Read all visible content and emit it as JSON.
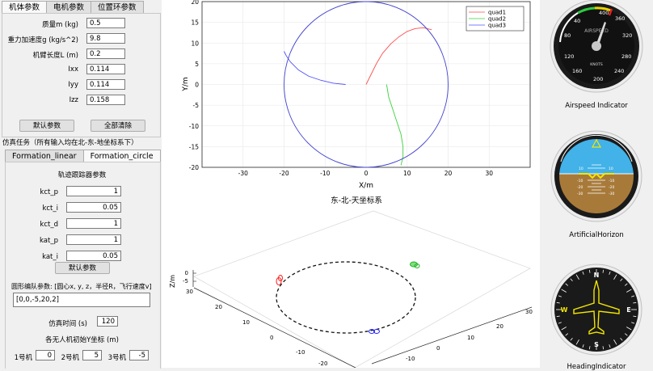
{
  "left": {
    "tabs_top": [
      "机体参数",
      "电机参数",
      "位置环参数"
    ],
    "params": [
      {
        "label": "质量m (kg)",
        "value": "0.5"
      },
      {
        "label": "重力加速度g (kg/s^2)",
        "value": "9.8"
      },
      {
        "label": "机臂长度L (m)",
        "value": "0.2"
      },
      {
        "label": "Ixx",
        "value": "0.114"
      },
      {
        "label": "Iyy",
        "value": "0.114"
      },
      {
        "label": "Izz",
        "value": "0.158"
      }
    ],
    "default_btn": "默认参数",
    "clear_btn": "全部清除",
    "task_title": "仿真任务（所有输入均在北-东-地坐标系下）",
    "tabs_task": [
      "Formation_linear",
      "Formation_circle"
    ],
    "ctrl_title": "轨迹跟踪器参数",
    "ctrl": [
      {
        "label": "kct_p",
        "value": "1"
      },
      {
        "label": "kct_i",
        "value": "0.05"
      },
      {
        "label": "kct_d",
        "value": "1"
      },
      {
        "label": "kat_p",
        "value": "1"
      },
      {
        "label": "kat_i",
        "value": "0.05"
      }
    ],
    "ctrl_default_btn": "默认参数",
    "circle_label": "圆形编队参数: [圆心x, y, z，半径R，飞行速度v]",
    "circle_value": "[0,0,-5,20,2]",
    "simtime_label": "仿真时间 (s)",
    "simtime_value": "120",
    "y_title": "各无人机初始Y坐标 (m)",
    "drones": [
      {
        "label": "1号机",
        "value": "0"
      },
      {
        "label": "2号机",
        "value": "5"
      },
      {
        "label": "3号机",
        "value": "-5"
      }
    ]
  },
  "plot2d": {
    "xlabel": "X/m",
    "ylabel": "Y/m",
    "xticks": [
      "-30",
      "-20",
      "-10",
      "0",
      "10",
      "20",
      "30"
    ],
    "yticks": [
      "20",
      "15",
      "10",
      "5",
      "0",
      "-5",
      "-10",
      "-15",
      "-20"
    ],
    "legend": [
      "quad1",
      "quad2",
      "quad3"
    ]
  },
  "plot3d": {
    "title": "东-北-天坐标系",
    "zlabel": "Z/m",
    "zticks": [
      "0",
      "-5"
    ],
    "xticks": [
      "30",
      "20",
      "10",
      "0",
      "-10",
      "-20"
    ],
    "yticks": [
      "30",
      "20",
      "10",
      "0",
      "-10"
    ]
  },
  "instruments": {
    "airspeed_label": "Airspeed Indicator",
    "airspeed_title": "AIRSPEED",
    "airspeed_unit": "KNOTS",
    "airspeed_nums": [
      "400",
      "360",
      "40",
      "320",
      "80",
      "280",
      "120",
      "240",
      "160",
      "200"
    ],
    "horizon_label": "ArtificialHorizon",
    "horizon_nums": [
      "10",
      "10",
      "-10",
      "-10",
      "-20",
      "-20",
      "-30",
      "-30"
    ],
    "heading_label": "HeadingIndicator",
    "heading_letters": [
      "N",
      "E",
      "S",
      "W"
    ]
  },
  "chart_data": {
    "type": "line",
    "xlabel": "X/m",
    "ylabel": "Y/m",
    "xlim": [
      -40,
      40
    ],
    "ylim": [
      -20,
      20
    ],
    "grid": true,
    "legend_position": "top-right",
    "series": [
      {
        "name": "quad1",
        "color": "#ff4d4d",
        "x": [
          0,
          1,
          2.5,
          4,
          6,
          8,
          10,
          12,
          14,
          16
        ],
        "y": [
          0,
          2,
          5,
          7.5,
          9.8,
          11.5,
          12.8,
          13.5,
          13.7,
          13.2
        ]
      },
      {
        "name": "quad2",
        "color": "#3ad13a",
        "x": [
          5,
          5.5,
          6.5,
          7.5,
          8.5,
          9.0,
          9.0,
          8.5
        ],
        "y": [
          0,
          -3,
          -6,
          -9,
          -12,
          -15,
          -17.5,
          -19.5
        ]
      },
      {
        "name": "quad3",
        "color": "#5050ff",
        "x": [
          -5,
          -8,
          -11,
          -14,
          -16.5,
          -18.5,
          -19.5,
          -20
        ],
        "y": [
          0,
          0.3,
          1.0,
          2.0,
          3.5,
          5.5,
          7.0,
          8.0
        ]
      },
      {
        "name": "",
        "color": "#4040d0",
        "x": [
          20,
          14.1,
          0,
          -14.1,
          -20,
          -14.1,
          0,
          14.1,
          20
        ],
        "y": [
          0,
          14.1,
          20,
          14.1,
          0,
          -14.1,
          -20,
          -14.1,
          0
        ]
      }
    ]
  }
}
